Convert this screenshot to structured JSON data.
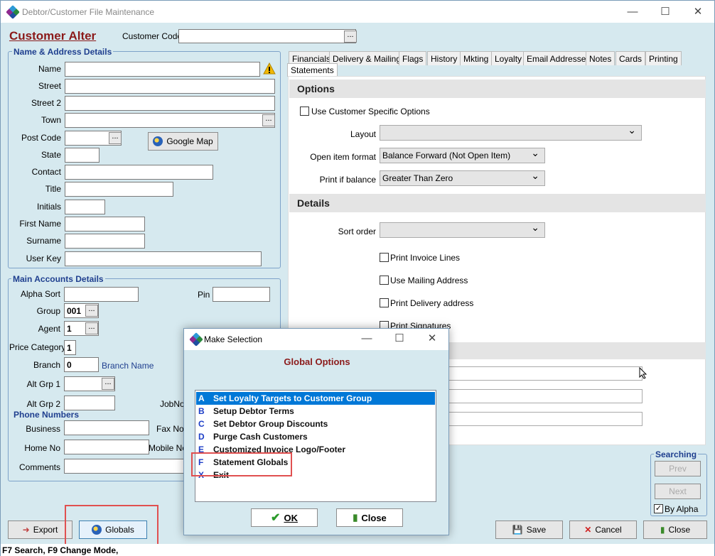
{
  "window": {
    "title": "Debtor/Customer File Maintenance",
    "minimize": "—",
    "maximize": "☐",
    "close": "✕"
  },
  "header": {
    "mode_title": "Customer Alter",
    "customer_code_label": "Customer Code",
    "customer_code_value": ""
  },
  "name_address": {
    "title": "Name & Address Details",
    "fields": {
      "name": "Name",
      "street": "Street",
      "street2": "Street 2",
      "town": "Town",
      "post_code": "Post Code",
      "state": "State",
      "contact": "Contact",
      "title": "Title",
      "initials": "Initials",
      "first_name": "First Name",
      "surname": "Surname",
      "user_key": "User Key"
    },
    "google_map": "Google Map"
  },
  "main_accounts": {
    "title": "Main Accounts Details",
    "alpha_sort": "Alpha Sort",
    "pin": "Pin",
    "group": "Group",
    "group_value": "001",
    "agent": "Agent",
    "agent_value": "1",
    "price_category": "Price Category",
    "price_category_value": "1",
    "branch": "Branch",
    "branch_value": "0",
    "branch_name": "Branch Name",
    "alt_grp1": "Alt Grp 1",
    "alt_grp2": "Alt Grp 2",
    "jobno": "JobNo"
  },
  "phone": {
    "title": "Phone Numbers",
    "business": "Business",
    "fax": "Fax No",
    "home": "Home No",
    "mobile": "Mobile No",
    "comments": "Comments"
  },
  "tabs": [
    "Financials",
    "Delivery & Mailing",
    "Flags",
    "History",
    "Mkting",
    "Loyalty",
    "Email Addresses",
    "Notes",
    "Cards",
    "Printing",
    "Statements"
  ],
  "statements": {
    "options_title": "Options",
    "use_customer_specific": "Use Customer Specific Options",
    "layout_label": "Layout",
    "layout_value": "",
    "open_item_label": "Open item format",
    "open_item_value": "Balance Forward (Not Open Item)",
    "print_if_label": "Print if balance",
    "print_if_value": "Greater Than Zero",
    "details_title": "Details",
    "sort_order_label": "Sort order",
    "sort_order_value": "",
    "print_invoice_lines": "Print Invoice Lines",
    "use_mailing_address": "Use Mailing Address",
    "print_delivery_address": "Print Delivery address",
    "print_signatures": "Print Signatures"
  },
  "searching": {
    "title": "Searching",
    "prev": "Prev",
    "next": "Next",
    "by_alpha": "By Alpha"
  },
  "buttons": {
    "export": "Export",
    "globals": "Globals",
    "save": "Save",
    "cancel": "Cancel",
    "close": "Close"
  },
  "status_bar": "F7 Search, F9 Change Mode,",
  "dialog": {
    "title": "Make Selection",
    "heading": "Global Options",
    "items": [
      {
        "key": "A",
        "label": "Set Loyalty Targets to Customer Group"
      },
      {
        "key": "B",
        "label": "Setup Debtor Terms"
      },
      {
        "key": "C",
        "label": "Set Debtor Group Discounts"
      },
      {
        "key": "D",
        "label": "Purge Cash Customers"
      },
      {
        "key": "E",
        "label": "Customized Invoice Logo/Footer"
      },
      {
        "key": "F",
        "label": "Statement Globals"
      },
      {
        "key": "X",
        "label": "Exit"
      }
    ],
    "ok": "OK",
    "close": "Close"
  },
  "colors": {
    "accent": "#0078d7",
    "title_red": "#8b1a1a",
    "group_blue": "#1f3f8f",
    "highlight": "#e05050"
  }
}
